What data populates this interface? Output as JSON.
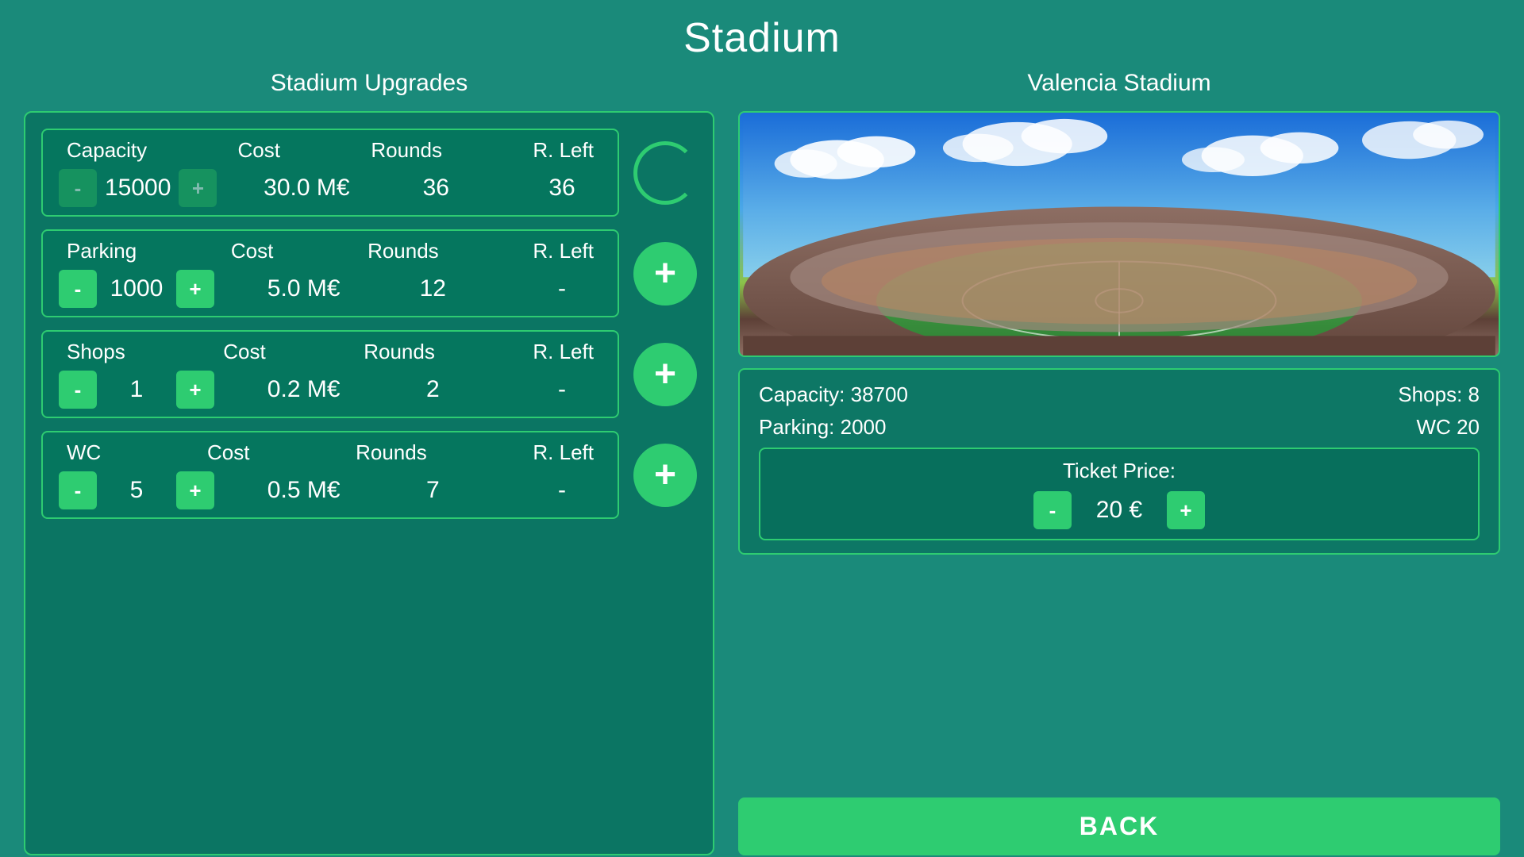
{
  "page": {
    "title": "Stadium"
  },
  "left": {
    "section_title": "Stadium Upgrades",
    "upgrades": [
      {
        "id": "capacity",
        "label": "Capacity",
        "cost_label": "Cost",
        "rounds_label": "Rounds",
        "rleft_label": "R. Left",
        "value": "15000",
        "cost": "30.0 M€",
        "rounds": "36",
        "rleft": "36",
        "btn_minus": "-",
        "btn_plus": "+",
        "action_type": "loading"
      },
      {
        "id": "parking",
        "label": "Parking",
        "cost_label": "Cost",
        "rounds_label": "Rounds",
        "rleft_label": "R. Left",
        "value": "1000",
        "cost": "5.0 M€",
        "rounds": "12",
        "rleft": "-",
        "btn_minus": "-",
        "btn_plus": "+",
        "action_type": "add"
      },
      {
        "id": "shops",
        "label": "Shops",
        "cost_label": "Cost",
        "rounds_label": "Rounds",
        "rleft_label": "R. Left",
        "value": "1",
        "cost": "0.2 M€",
        "rounds": "2",
        "rleft": "-",
        "btn_minus": "-",
        "btn_plus": "+",
        "action_type": "add"
      },
      {
        "id": "wc",
        "label": "WC",
        "cost_label": "Cost",
        "rounds_label": "Rounds",
        "rleft_label": "R. Left",
        "value": "5",
        "cost": "0.5 M€",
        "rounds": "7",
        "rleft": "-",
        "btn_minus": "-",
        "btn_plus": "+",
        "action_type": "add"
      }
    ]
  },
  "right": {
    "section_title": "Valencia Stadium",
    "stats": {
      "capacity_label": "Capacity:",
      "capacity_value": "38700",
      "shops_label": "Shops:",
      "shops_value": "8",
      "parking_label": "Parking:",
      "parking_value": "2000",
      "wc_label": "WC",
      "wc_value": "20"
    },
    "ticket": {
      "label": "Ticket Price:",
      "value": "20 €",
      "btn_minus": "-",
      "btn_plus": "+"
    },
    "back_btn": "BACK"
  }
}
